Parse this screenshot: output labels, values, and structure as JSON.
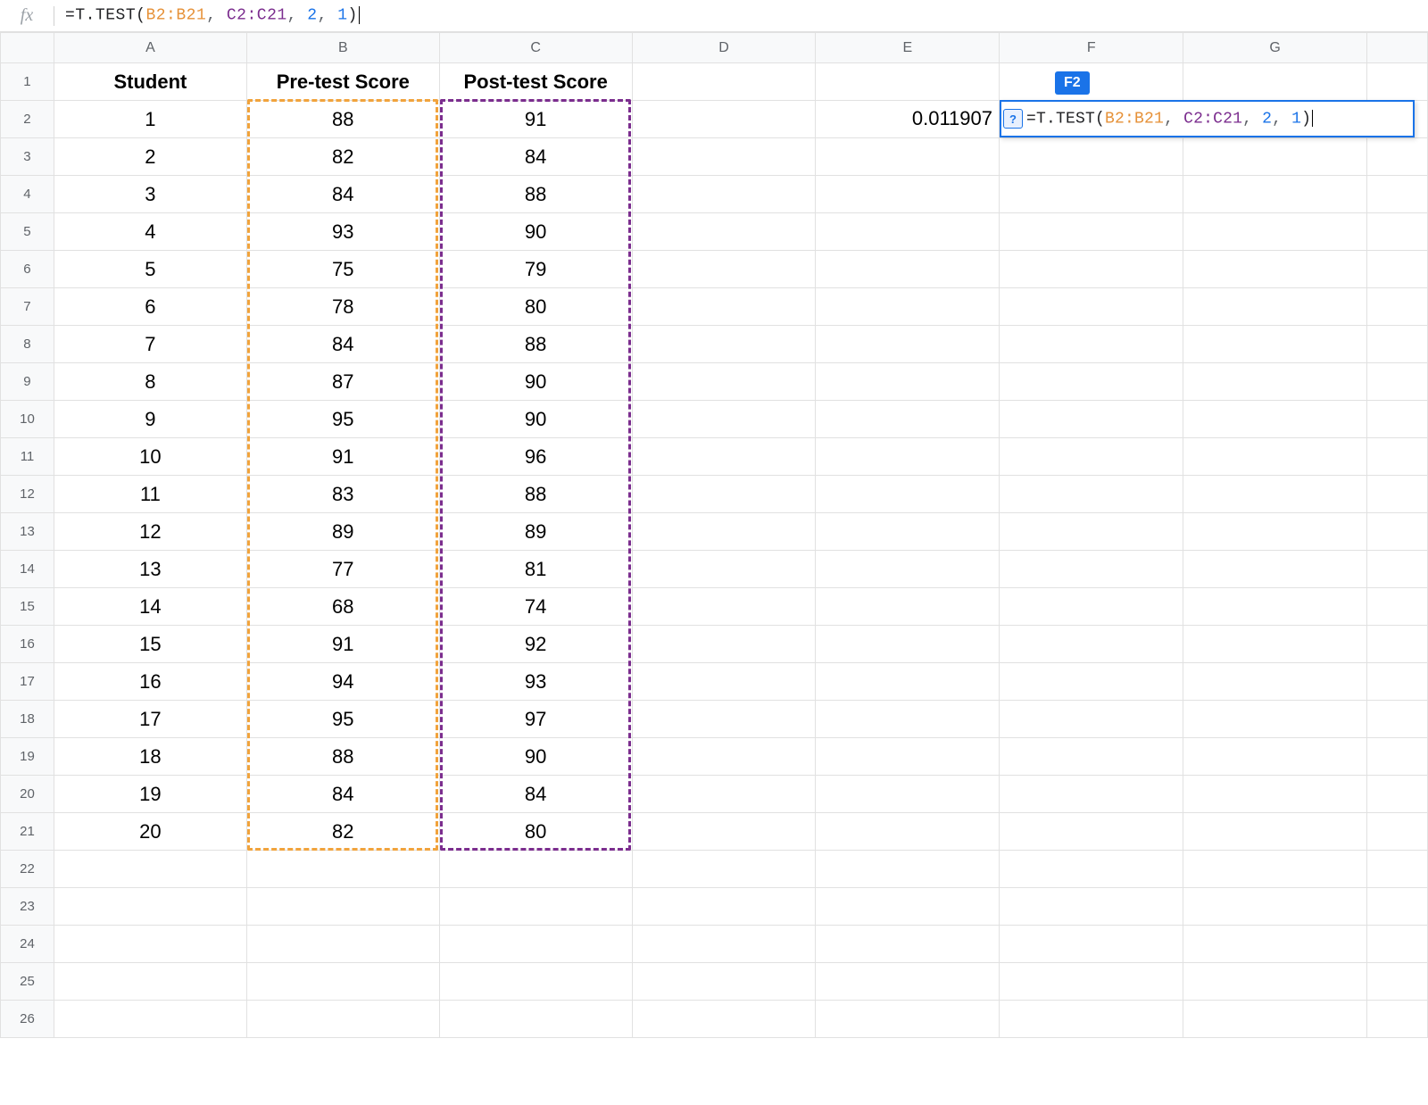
{
  "formula_bar": {
    "fx_label": "fx",
    "eq": "=",
    "func_name": "T.TEST",
    "lparen": "(",
    "range1": "B2:B21",
    "comma1": ", ",
    "range2": "C2:C21",
    "comma2": ", ",
    "arg3": "2",
    "comma3": ", ",
    "arg4": "1",
    "rparen": ")"
  },
  "columns": {
    "A": "A",
    "B": "B",
    "C": "C",
    "D": "D",
    "E": "E",
    "F": "F",
    "G": "G"
  },
  "row_numbers": [
    "1",
    "2",
    "3",
    "4",
    "5",
    "6",
    "7",
    "8",
    "9",
    "10",
    "11",
    "12",
    "13",
    "14",
    "15",
    "16",
    "17",
    "18",
    "19",
    "20",
    "21",
    "22",
    "23",
    "24",
    "25",
    "26"
  ],
  "headers": {
    "student": "Student",
    "pre": "Pre-test Score",
    "post": "Post-test Score"
  },
  "table": {
    "student": [
      "1",
      "2",
      "3",
      "4",
      "5",
      "6",
      "7",
      "8",
      "9",
      "10",
      "11",
      "12",
      "13",
      "14",
      "15",
      "16",
      "17",
      "18",
      "19",
      "20"
    ],
    "pre": [
      "88",
      "82",
      "84",
      "93",
      "75",
      "78",
      "84",
      "87",
      "95",
      "91",
      "83",
      "89",
      "77",
      "68",
      "91",
      "94",
      "95",
      "88",
      "84",
      "82"
    ],
    "post": [
      "91",
      "84",
      "88",
      "90",
      "79",
      "80",
      "88",
      "90",
      "90",
      "96",
      "88",
      "89",
      "81",
      "74",
      "92",
      "93",
      "97",
      "90",
      "84",
      "80"
    ]
  },
  "active_cell": {
    "ref_label": "F2",
    "help_badge": "?",
    "eq": "=",
    "func_name": "T.TEST",
    "lparen": "(",
    "range1": "B2:B21",
    "comma1": ", ",
    "range2": "C2:C21",
    "comma2": ", ",
    "arg3": "2",
    "comma3": ", ",
    "arg4": "1",
    "rparen": ")"
  },
  "result_preview": "0.011907",
  "chart_data": {
    "type": "table",
    "title": "Pre-test vs Post-test Scores",
    "columns": [
      "Student",
      "Pre-test Score",
      "Post-test Score"
    ],
    "rows": [
      [
        1,
        88,
        91
      ],
      [
        2,
        82,
        84
      ],
      [
        3,
        84,
        88
      ],
      [
        4,
        93,
        90
      ],
      [
        5,
        75,
        79
      ],
      [
        6,
        78,
        80
      ],
      [
        7,
        84,
        88
      ],
      [
        8,
        87,
        90
      ],
      [
        9,
        95,
        90
      ],
      [
        10,
        91,
        96
      ],
      [
        11,
        83,
        88
      ],
      [
        12,
        89,
        89
      ],
      [
        13,
        77,
        81
      ],
      [
        14,
        68,
        74
      ],
      [
        15,
        91,
        92
      ],
      [
        16,
        94,
        93
      ],
      [
        17,
        95,
        97
      ],
      [
        18,
        88,
        90
      ],
      [
        19,
        84,
        84
      ],
      [
        20,
        82,
        80
      ]
    ],
    "statistic": {
      "function": "T.TEST",
      "range1": "B2:B21",
      "range2": "C2:C21",
      "tails": 2,
      "type": 1,
      "p_value": 0.011907
    }
  }
}
